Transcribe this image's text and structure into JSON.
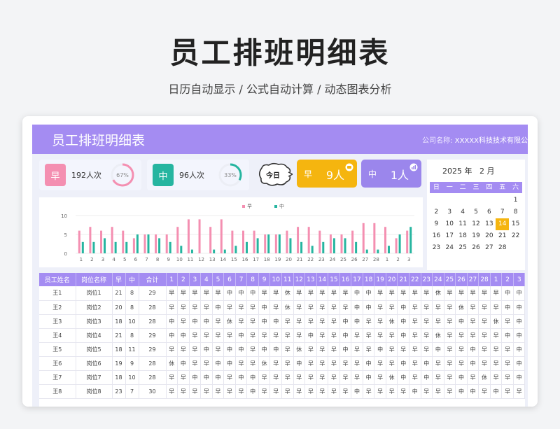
{
  "hero": {
    "title": "员工排班明细表",
    "subtitle": "日历自动显示 /  公式自动计算  /  动态图表分析"
  },
  "banner": {
    "title": "员工排班明细表",
    "company_label": "公司名称:",
    "company_value": "XXXXX科技技术有限公"
  },
  "stats": [
    {
      "badge": "早",
      "count": "192人次",
      "pct_label": "67%",
      "pct": 0.67,
      "color": "#f48fb1"
    },
    {
      "badge": "中",
      "count": "96人次",
      "pct_label": "33%",
      "pct": 0.33,
      "color": "#26b5a0"
    }
  ],
  "today": {
    "label": "今日"
  },
  "shift_summary": [
    {
      "label": "早",
      "value": "9人",
      "color": "#f5b50f"
    },
    {
      "label": "中",
      "value": "1人",
      "color": "#9b86ec"
    }
  ],
  "chart_data": {
    "type": "bar",
    "categories": [
      "1",
      "2",
      "3",
      "4",
      "5",
      "6",
      "7",
      "8",
      "9",
      "10",
      "11",
      "12",
      "13",
      "14",
      "15",
      "16",
      "17",
      "18",
      "19",
      "20",
      "21",
      "22",
      "23",
      "24",
      "25",
      "26",
      "27",
      "28",
      "1",
      "2",
      "3"
    ],
    "series": [
      {
        "name": "早",
        "values": [
          6,
          7,
          6,
          7,
          6,
          4,
          5,
          5,
          5,
          7,
          9,
          9,
          7,
          9,
          6,
          6,
          6,
          5,
          5,
          6,
          7,
          7,
          6,
          5,
          5,
          6,
          8,
          8,
          7,
          4,
          6
        ]
      },
      {
        "name": "中",
        "values": [
          3,
          3,
          4,
          3,
          3,
          5,
          5,
          4,
          3,
          2,
          1,
          0,
          1,
          1,
          2,
          3,
          4,
          5,
          5,
          4,
          3,
          2,
          3,
          4,
          4,
          3,
          1,
          1,
          2,
          5,
          7
        ]
      }
    ],
    "ylim": [
      0,
      10
    ],
    "yticks": [
      0,
      5,
      10
    ],
    "legend": "top-center",
    "colors": [
      "#f48fb1",
      "#26b5a0"
    ]
  },
  "calendar": {
    "year": "2025",
    "year_suffix": "年",
    "month": "2",
    "month_suffix": "月",
    "weekdays": [
      "日",
      "一",
      "二",
      "三",
      "四",
      "五",
      "六"
    ],
    "days": [
      "",
      "",
      "",
      "",
      "",
      "",
      "1",
      "2",
      "3",
      "4",
      "5",
      "6",
      "7",
      "8",
      "9",
      "10",
      "11",
      "12",
      "13",
      "14",
      "15",
      "16",
      "17",
      "18",
      "19",
      "20",
      "21",
      "22",
      "23",
      "24",
      "25",
      "26",
      "27",
      "28",
      ""
    ],
    "today": "14"
  },
  "table": {
    "headers": [
      "员工姓名",
      "岗位名称",
      "早",
      "中",
      "合计",
      "1",
      "2",
      "3",
      "4",
      "5",
      "6",
      "7",
      "8",
      "9",
      "10",
      "11",
      "12",
      "13",
      "14",
      "15",
      "16",
      "17",
      "18",
      "19",
      "20",
      "21",
      "22",
      "23",
      "24",
      "25",
      "26",
      "27",
      "28",
      "1",
      "2",
      "3"
    ],
    "rows": [
      [
        "王1",
        "岗位1",
        "21",
        "8",
        "29",
        "早",
        "早",
        "早",
        "早",
        "早",
        "中",
        "中",
        "中",
        "早",
        "早",
        "休",
        "早",
        "早",
        "早",
        "早",
        "早",
        "中",
        "中",
        "早",
        "早",
        "早",
        "早",
        "早",
        "休",
        "早",
        "早",
        "早",
        "早",
        "早",
        "中",
        "中"
      ],
      [
        "王2",
        "岗位2",
        "20",
        "8",
        "28",
        "早",
        "早",
        "早",
        "早",
        "中",
        "早",
        "早",
        "早",
        "中",
        "早",
        "休",
        "早",
        "早",
        "早",
        "早",
        "早",
        "中",
        "中",
        "早",
        "早",
        "中",
        "早",
        "早",
        "早",
        "早",
        "休",
        "早",
        "早",
        "早",
        "中",
        "中"
      ],
      [
        "王3",
        "岗位3",
        "18",
        "10",
        "28",
        "中",
        "早",
        "中",
        "中",
        "早",
        "休",
        "早",
        "早",
        "中",
        "中",
        "早",
        "早",
        "早",
        "早",
        "早",
        "中",
        "中",
        "早",
        "早",
        "休",
        "中",
        "早",
        "早",
        "早",
        "早",
        "中",
        "早",
        "早",
        "休",
        "早",
        "中"
      ],
      [
        "王4",
        "岗位4",
        "21",
        "8",
        "29",
        "中",
        "中",
        "早",
        "早",
        "早",
        "早",
        "中",
        "早",
        "早",
        "早",
        "早",
        "早",
        "中",
        "早",
        "早",
        "中",
        "早",
        "早",
        "早",
        "早",
        "中",
        "早",
        "早",
        "休",
        "早",
        "早",
        "早",
        "早",
        "早",
        "中",
        "中"
      ],
      [
        "王5",
        "岗位5",
        "18",
        "11",
        "29",
        "早",
        "早",
        "早",
        "中",
        "早",
        "中",
        "中",
        "早",
        "中",
        "中",
        "早",
        "休",
        "早",
        "早",
        "早",
        "中",
        "早",
        "早",
        "中",
        "早",
        "早",
        "早",
        "早",
        "中",
        "早",
        "早",
        "中",
        "早",
        "早",
        "早",
        "中"
      ],
      [
        "王6",
        "岗位6",
        "19",
        "9",
        "28",
        "休",
        "中",
        "早",
        "早",
        "中",
        "中",
        "早",
        "早",
        "休",
        "早",
        "早",
        "中",
        "早",
        "早",
        "早",
        "早",
        "早",
        "中",
        "早",
        "早",
        "中",
        "早",
        "中",
        "早",
        "早",
        "早",
        "中",
        "早",
        "早",
        "早",
        "中"
      ],
      [
        "王7",
        "岗位7",
        "18",
        "10",
        "28",
        "早",
        "早",
        "中",
        "中",
        "中",
        "早",
        "中",
        "中",
        "早",
        "早",
        "早",
        "早",
        "早",
        "早",
        "早",
        "早",
        "早",
        "中",
        "早",
        "休",
        "中",
        "早",
        "中",
        "早",
        "早",
        "中",
        "早",
        "休",
        "早",
        "早",
        "中"
      ],
      [
        "王8",
        "岗位8",
        "23",
        "7",
        "30",
        "早",
        "早",
        "早",
        "早",
        "早",
        "早",
        "早",
        "中",
        "早",
        "早",
        "早",
        "早",
        "早",
        "早",
        "早",
        "早",
        "中",
        "早",
        "早",
        "早",
        "早",
        "中",
        "早",
        "早",
        "早",
        "中",
        "中",
        "早",
        "中",
        "早",
        "早"
      ]
    ]
  }
}
